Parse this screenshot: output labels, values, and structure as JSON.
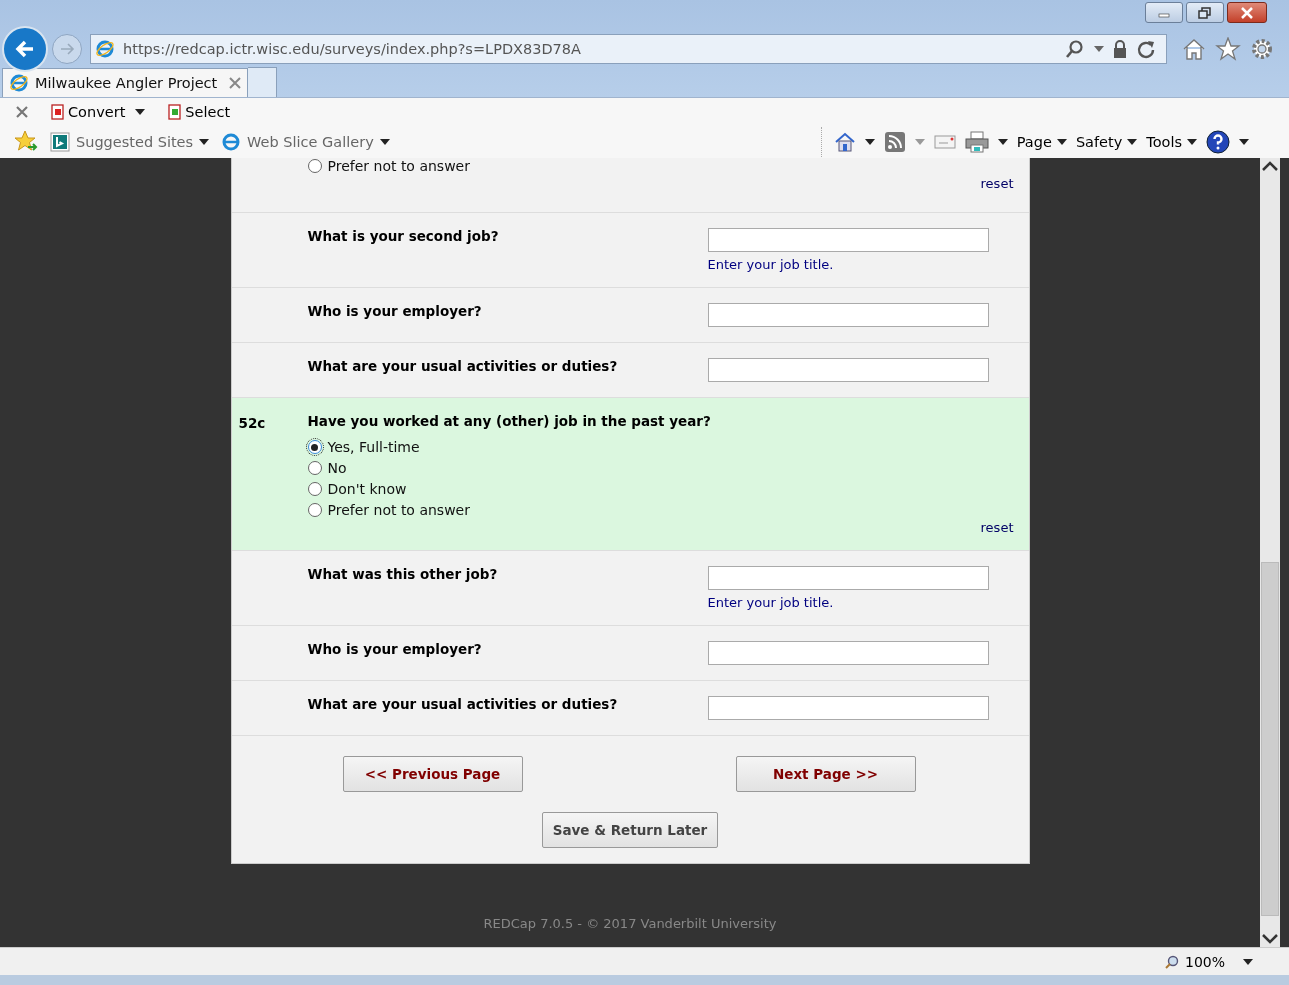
{
  "browser": {
    "url": "https://redcap.ictr.wisc.edu/surveys/index.php?s=LPDX83D78A",
    "tab_title": "Milwaukee Angler Project",
    "toolbar": [
      "Convert",
      "Select"
    ],
    "favorites": [
      "Suggested Sites",
      "Web Slice Gallery"
    ],
    "commands": [
      "Page",
      "Safety",
      "Tools"
    ],
    "zoom": "100%"
  },
  "survey": {
    "rows": [
      {
        "kind": "radio",
        "number": "",
        "question": "",
        "options": [
          {
            "label": "Prefer not to answer",
            "selected": false
          }
        ],
        "reset": "reset"
      },
      {
        "kind": "text",
        "question": "What is your second job?",
        "value": "",
        "note": "Enter your job title."
      },
      {
        "kind": "text",
        "question": "Who is your employer?",
        "value": ""
      },
      {
        "kind": "text",
        "question": "What are your usual activities or duties?",
        "value": ""
      },
      {
        "kind": "radio",
        "highlight": true,
        "number": "52c",
        "question": "Have you worked at any (other) job in the past year?",
        "options": [
          {
            "label": "Yes, Full-time",
            "selected": true
          },
          {
            "label": "No",
            "selected": false
          },
          {
            "label": "Don't know",
            "selected": false
          },
          {
            "label": "Prefer not to answer",
            "selected": false
          }
        ],
        "reset": "reset"
      },
      {
        "kind": "text",
        "question": "What was this other job?",
        "value": "",
        "note": "Enter your job title."
      },
      {
        "kind": "text",
        "question": "Who is your employer?",
        "value": ""
      },
      {
        "kind": "text",
        "question": "What are your usual activities or duties?",
        "value": ""
      }
    ],
    "prev": "<< Previous Page",
    "next": "Next Page >>",
    "save": "Save & Return Later"
  },
  "footer": "REDCap 7.0.5 - © 2017 Vanderbilt University"
}
